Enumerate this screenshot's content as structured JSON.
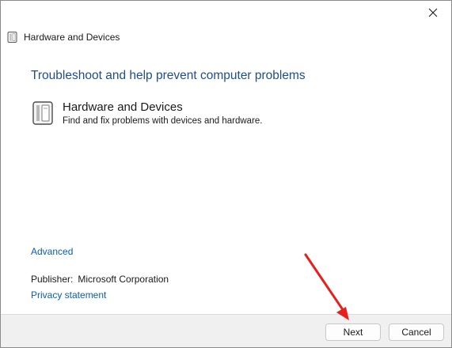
{
  "window": {
    "nav_title": "Hardware and Devices",
    "close_icon": "close-icon"
  },
  "main": {
    "heading": "Troubleshoot and help prevent computer problems",
    "item": {
      "icon": "hardware-device-icon",
      "title": "Hardware and Devices",
      "description": "Find and fix problems with devices and hardware."
    },
    "advanced_link": "Advanced",
    "publisher_label": "Publisher:",
    "publisher_value": "Microsoft Corporation",
    "privacy_link": "Privacy statement"
  },
  "footer": {
    "next_label": "Next",
    "cancel_label": "Cancel"
  },
  "annotation": {
    "arrow_color": "#e8201c",
    "arrow_target": "next-button"
  },
  "colors": {
    "heading": "#1e4e8c",
    "link": "#0a5fb4",
    "footer_bg": "#f0f0f0"
  }
}
